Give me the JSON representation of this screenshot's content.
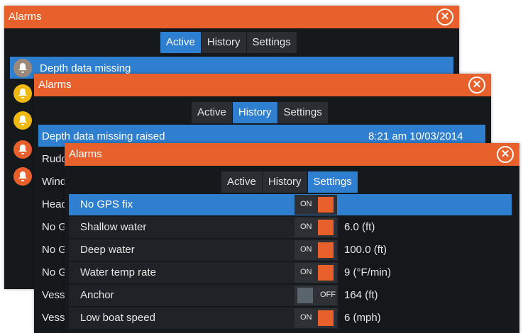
{
  "windows": {
    "active": {
      "title": "Alarms",
      "tabs": [
        "Active",
        "History",
        "Settings"
      ],
      "selected_row": "Depth data missing"
    },
    "history": {
      "title": "Alarms",
      "tabs": [
        "Active",
        "History",
        "Settings"
      ],
      "selected_row": {
        "label": "Depth data missing raised",
        "time": "8:21 am 10/03/2014"
      },
      "row_prefixes": [
        "Rudd",
        "Wind",
        "Head",
        "No G",
        "No G",
        "No G",
        "Vess",
        "Vess"
      ]
    },
    "settings": {
      "title": "Alarms",
      "tabs": [
        "Active",
        "History",
        "Settings"
      ],
      "rows": [
        {
          "name": "No GPS fix",
          "state": "ON",
          "value": ""
        },
        {
          "name": "Shallow water",
          "state": "ON",
          "value": "6.0 (ft)"
        },
        {
          "name": "Deep water",
          "state": "ON",
          "value": "100.0 (ft)"
        },
        {
          "name": "Water temp rate",
          "state": "ON",
          "value": "9 (°F/min)"
        },
        {
          "name": "Anchor",
          "state": "OFF",
          "value": "164 (ft)"
        },
        {
          "name": "Low boat speed",
          "state": "ON",
          "value": "6 (mph)"
        }
      ]
    }
  },
  "colors": {
    "title_bar": "#e8602b",
    "selection": "#2f7fd0",
    "toggle_on": "#e8602b",
    "toggle_off": "#5a646c",
    "alarm_yellow": "#f0b90f",
    "alarm_orange": "#e8602b",
    "alarm_gray": "#9b8a7a"
  },
  "icons": {
    "close": "close-icon",
    "alarm": "bell-icon"
  }
}
